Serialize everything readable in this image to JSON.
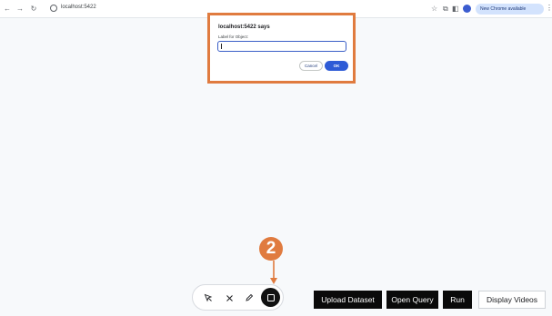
{
  "browser": {
    "url": "localhost:5422",
    "update_label": "New Chrome available",
    "icons": [
      "back-icon",
      "forward-icon",
      "reload-icon",
      "site-info-icon",
      "star-icon",
      "extensions-icon",
      "sidebar-icon",
      "profile-icon",
      "menu-icon"
    ]
  },
  "dialog": {
    "title": "localhost:5422 says",
    "prompt_label": "Label for Object:",
    "input_value": "",
    "cancel_label": "Cancel",
    "ok_label": "OK",
    "highlight_color": "#e07b3f"
  },
  "annotation": {
    "step_number": "2",
    "color": "#e07b3f"
  },
  "toolbar": {
    "tools": [
      {
        "name": "select-pointer-icon"
      },
      {
        "name": "close-icon"
      },
      {
        "name": "pencil-icon"
      },
      {
        "name": "rectangle-icon",
        "selected": true
      }
    ]
  },
  "actions": {
    "upload_label": "Upload Dataset",
    "open_query_label": "Open Query",
    "run_label": "Run",
    "display_videos_label": "Display Videos"
  }
}
